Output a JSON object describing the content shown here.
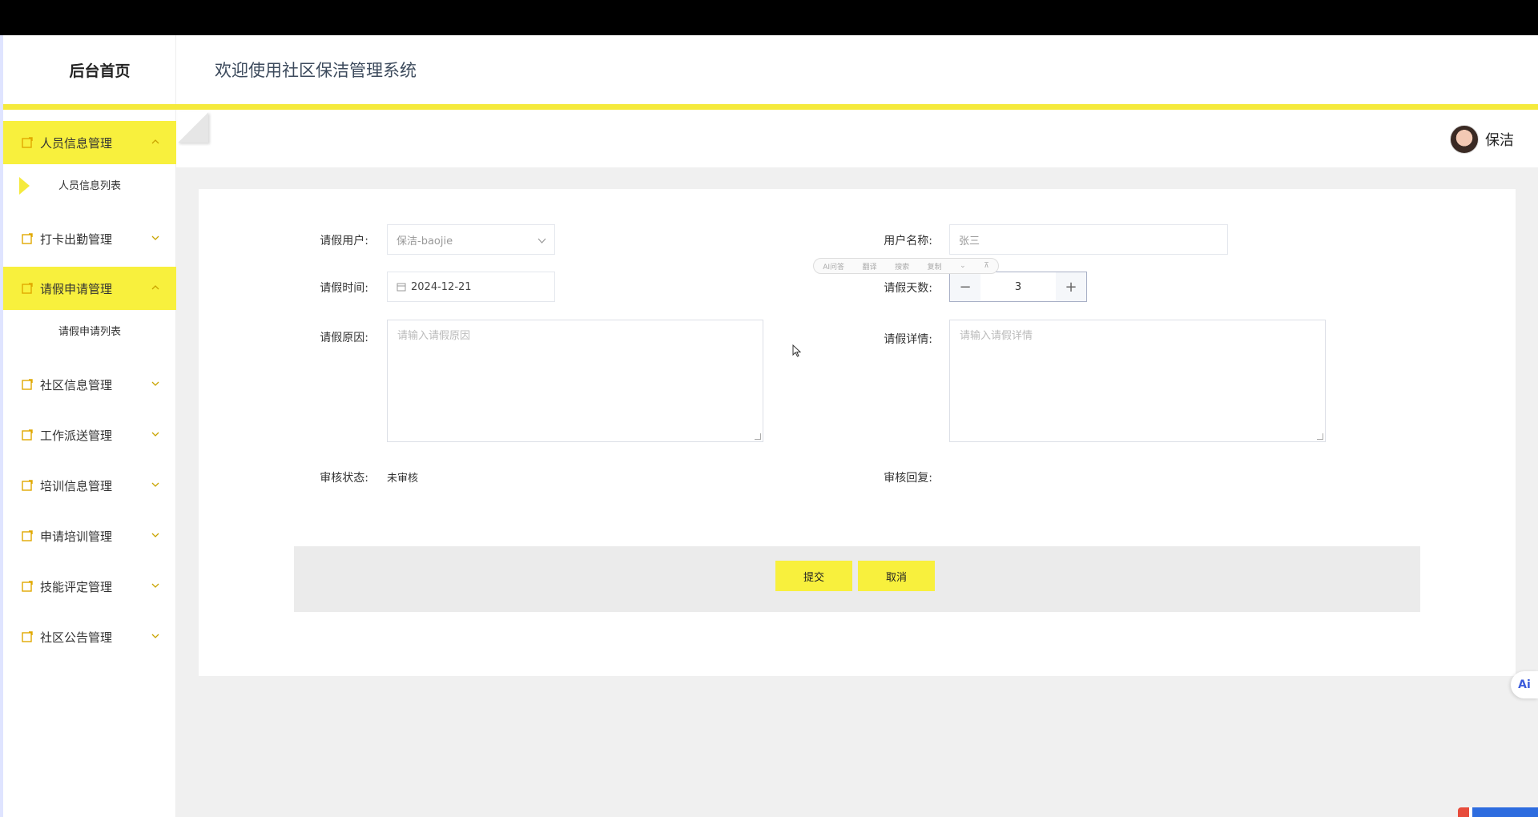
{
  "header": {
    "brand": "后台首页",
    "system_title": "欢迎使用社区保洁管理系统"
  },
  "sidebar": {
    "items": [
      {
        "label": "人员信息管理",
        "expanded": true
      },
      {
        "label": "打卡出勤管理",
        "expanded": false
      },
      {
        "label": "请假申请管理",
        "expanded": true
      },
      {
        "label": "社区信息管理",
        "expanded": false
      },
      {
        "label": "工作派送管理",
        "expanded": false
      },
      {
        "label": "培训信息管理",
        "expanded": false
      },
      {
        "label": "申请培训管理",
        "expanded": false
      },
      {
        "label": "技能评定管理",
        "expanded": false
      },
      {
        "label": "社区公告管理",
        "expanded": false
      }
    ],
    "sub_items": {
      "personnel_list": "人员信息列表",
      "leave_list": "请假申请列表"
    }
  },
  "user": {
    "name": "保洁"
  },
  "form": {
    "leave_user_label": "请假用户:",
    "leave_user_value": "保洁-baojie",
    "username_label": "用户名称:",
    "username_value": "张三",
    "leave_time_label": "请假时间:",
    "leave_time_value": "2024-12-21",
    "leave_days_label": "请假天数:",
    "leave_days_value": "3",
    "reason_label": "请假原因:",
    "reason_placeholder": "请输入请假原因",
    "detail_label": "请假详情:",
    "detail_placeholder": "请输入请假详情",
    "review_status_label": "审核状态:",
    "review_status_value": "未审核",
    "review_reply_label": "审核回复:",
    "review_reply_value": ""
  },
  "buttons": {
    "submit": "提交",
    "cancel": "取消"
  },
  "float_toolbar": {
    "items": [
      "AI问答",
      "翻译",
      "搜索",
      "复制",
      "⌄",
      "⊼"
    ]
  },
  "ai_badge": "Ai",
  "colors": {
    "accent": "#f8f03d",
    "header_line": "#f5ea3c",
    "background": "#f0f0f0"
  }
}
